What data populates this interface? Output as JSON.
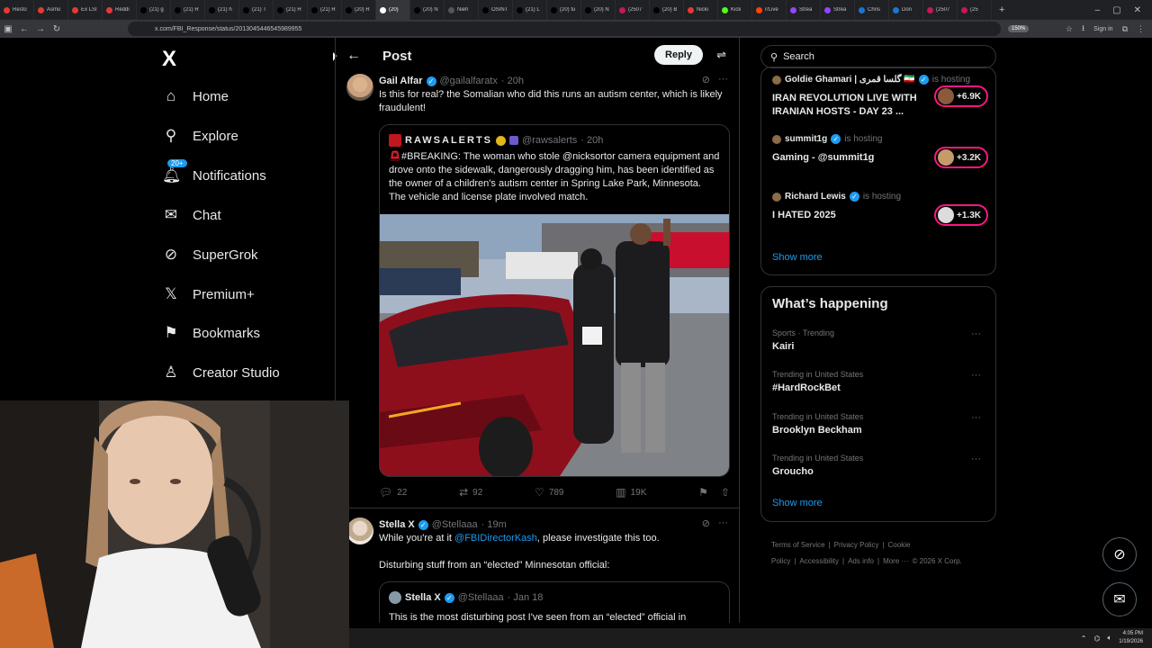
{
  "browser": {
    "tabs": [
      "Resto",
      "Asmo",
      "Ex LSI",
      "Reddi",
      "(21) g",
      "(21) R",
      "(21) h",
      "(21) T",
      "(21) H",
      "(21) R",
      "(20) R",
      "(20)",
      "(20) N",
      "Nieh",
      "OSINT",
      "(21) L",
      "(20) tu",
      "(20) N",
      "(2507",
      "(20) B",
      "Nicki",
      "Kick",
      "r/Live",
      "Strea",
      "Strea",
      "Chris",
      "Don",
      "(2507",
      "(25"
    ],
    "tab_colors": [
      "#e53935",
      "#e53935",
      "#e53935",
      "#e53935",
      "#000000",
      "#000000",
      "#000000",
      "#000000",
      "#000000",
      "#000000",
      "#000000",
      "#ffffff",
      "#000000",
      "#555555",
      "#000000",
      "#000000",
      "#000000",
      "#000000",
      "#c2185b",
      "#000000",
      "#e53935",
      "#53fc18",
      "#ff4500",
      "#9146ff",
      "#9146ff",
      "#1976d2",
      "#1976d2",
      "#c2185b",
      "#c2185b"
    ],
    "active_tab_index": 11,
    "url": "x.com/FBI_Response/status/2013045446545989955",
    "zoom": "150%",
    "sign_in": "Sign in"
  },
  "sidebar": {
    "logo": "X",
    "items": [
      {
        "label": "Home",
        "icon": "home-icon",
        "glyph": "⌂"
      },
      {
        "label": "Explore",
        "icon": "search-icon",
        "glyph": "⚲"
      },
      {
        "label": "Notifications",
        "icon": "bell-icon",
        "glyph": "🔔︎",
        "badge": "20+"
      },
      {
        "label": "Chat",
        "icon": "mail-icon",
        "glyph": "✉"
      },
      {
        "label": "SuperGrok",
        "icon": "grok-icon",
        "glyph": "⊘"
      },
      {
        "label": "Premium+",
        "icon": "x-premium-icon",
        "glyph": "𝕏"
      },
      {
        "label": "Bookmarks",
        "icon": "bookmark-icon",
        "glyph": "⚑"
      },
      {
        "label": "Creator Studio",
        "icon": "creator-studio-icon",
        "glyph": "♙"
      }
    ]
  },
  "main": {
    "title": "Post",
    "reply_label": "Reply",
    "tweet": {
      "name": "Gail Alfar",
      "handle": "@gailalfaratx",
      "time": "· 20h",
      "text": "Is this for real? the Somalian who did this runs an autism center, which is likely fraudulent!",
      "quote": {
        "name": "RAWSALERTS",
        "handle": "@rawsalerts",
        "time": "· 20h",
        "text": "#BREAKING: The woman who stole @nicksortor camera equipment and drove onto the sidewalk, dangerously dragging him, has been identified as the owner of a children's autism center in Spring Lake Park, Minnesota. The vehicle and license plate involved match."
      },
      "stats": {
        "replies": "22",
        "reposts": "92",
        "likes": "789",
        "views": "19K"
      }
    },
    "reply_tweet": {
      "name": "Stella X",
      "handle": "@Stellaaa",
      "time": "· 19m",
      "text_pre": "While you're at it ",
      "mention": "@FBIDirectorKash",
      "text_post": ", please investigate this too.",
      "text2": "Disturbing stuff from an “elected” Minnesotan official:",
      "quote": {
        "name": "Stella X",
        "handle": "@Stellaaa",
        "time": "· Jan 18",
        "text": "This is the most disturbing post I've seen from an “elected” official in"
      }
    }
  },
  "right": {
    "search_placeholder": "Search",
    "live": [
      {
        "host": "Goldie Ghamari | گلسا قمری 🇮🇷",
        "hosting": "is hosting",
        "title": "IRAN REVOLUTION LIVE WITH IRANIAN HOSTS - DAY 23 ...",
        "count": "+6.9K"
      },
      {
        "host": "summit1g",
        "hosting": "is hosting",
        "title": "Gaming - @summit1g",
        "count": "+3.2K"
      },
      {
        "host": "Richard Lewis",
        "hosting": "is hosting",
        "title": "I HATED 2025",
        "count": "+1.3K"
      }
    ],
    "show_more": "Show more",
    "whats_happening": "What’s happening",
    "trends": [
      {
        "context": "Sports · Trending",
        "name": "Kairi"
      },
      {
        "context": "Trending in United States",
        "name": "#HardRockBet"
      },
      {
        "context": "Trending in United States",
        "name": "Brooklyn Beckham"
      },
      {
        "context": "Trending in United States",
        "name": "Groucho"
      }
    ],
    "footer": [
      "Terms of Service",
      "|",
      "Privacy Policy",
      "|",
      "Cookie Policy",
      "|",
      "Accessibility",
      "|",
      "Ads info",
      "|",
      "More ···",
      "© 2026 X Corp."
    ]
  },
  "taskbar": {
    "time": "4:05 PM",
    "date": "1/19/2026"
  }
}
